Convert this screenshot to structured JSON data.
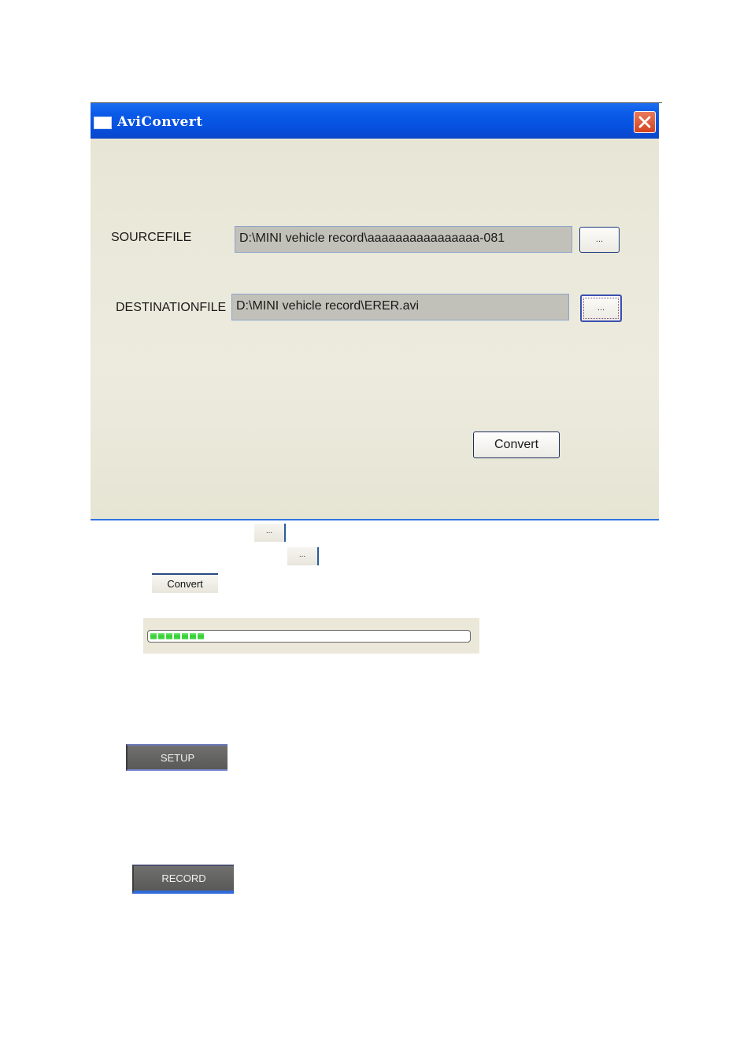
{
  "window": {
    "title": "AviConvert",
    "icon": "window-app-icon",
    "close_icon": "close-x-icon"
  },
  "form": {
    "source": {
      "label": "SOURCEFILE",
      "value": "D:\\MINI vehicle record\\aaaaaaaaaaaaaaaa-081",
      "browse_label": "..."
    },
    "destination": {
      "label": "DESTINATIONFILE",
      "value": "D:\\MINI vehicle record\\ERER.avi",
      "browse_label": "..."
    },
    "convert_label": "Convert"
  },
  "snippets": {
    "browse_button_1_label": "...",
    "browse_button_2_label": "...",
    "convert_button_label": "Convert"
  },
  "progress": {
    "percent": 16,
    "segments_filled": 7,
    "color": "#2fcf2f"
  },
  "buttons": {
    "setup_label": "SETUP",
    "record_label": "RECORD"
  }
}
